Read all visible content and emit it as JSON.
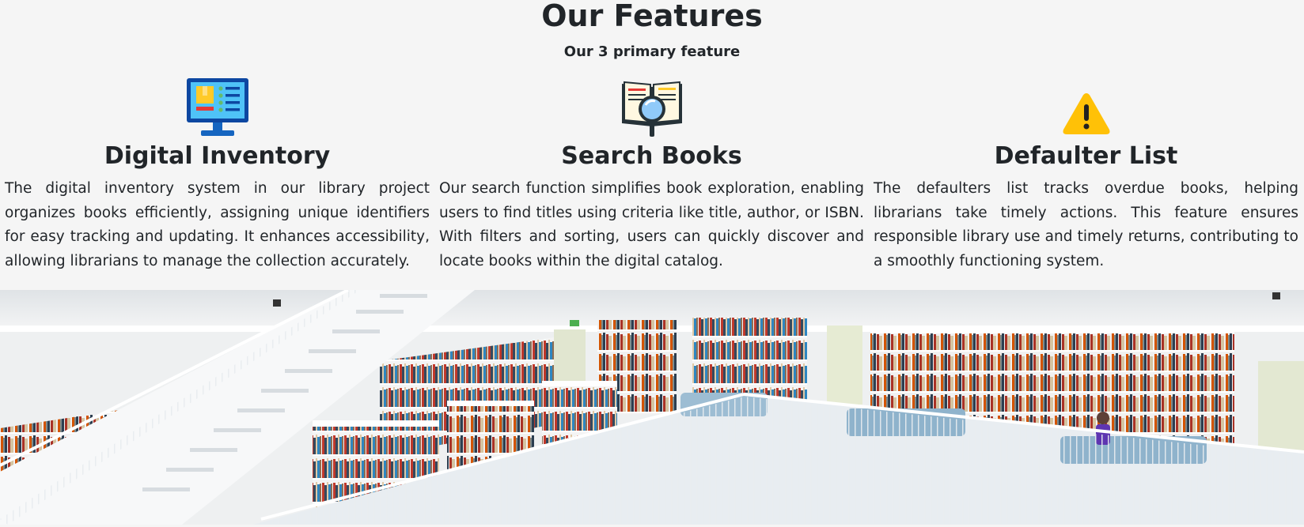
{
  "section": {
    "title": "Our Features",
    "subtitle": "Our 3 primary feature"
  },
  "features": [
    {
      "icon": "computer-monitor-icon",
      "title": "Digital Inventory",
      "text": "The digital inventory system in our library project organizes books efficiently, assigning unique identifiers for easy tracking and updating. It enhances accessibility, allowing librarians to manage the collection accurately."
    },
    {
      "icon": "book-search-icon",
      "title": "Search Books",
      "text": "Our search function simplifies book exploration, enabling users to find titles using criteria like title, author, or ISBN. With filters and sorting, users can quickly discover and locate books within the digital catalog."
    },
    {
      "icon": "warning-icon",
      "title": "Defaulter List",
      "text": "The defaulters list tracks overdue books, helping librarians take timely actions. This feature ensures responsible library use and timely returns, contributing to a smoothly functioning system."
    }
  ],
  "colors": {
    "background": "#f5f5f5",
    "text": "#212529",
    "warning": "#ffc107"
  }
}
